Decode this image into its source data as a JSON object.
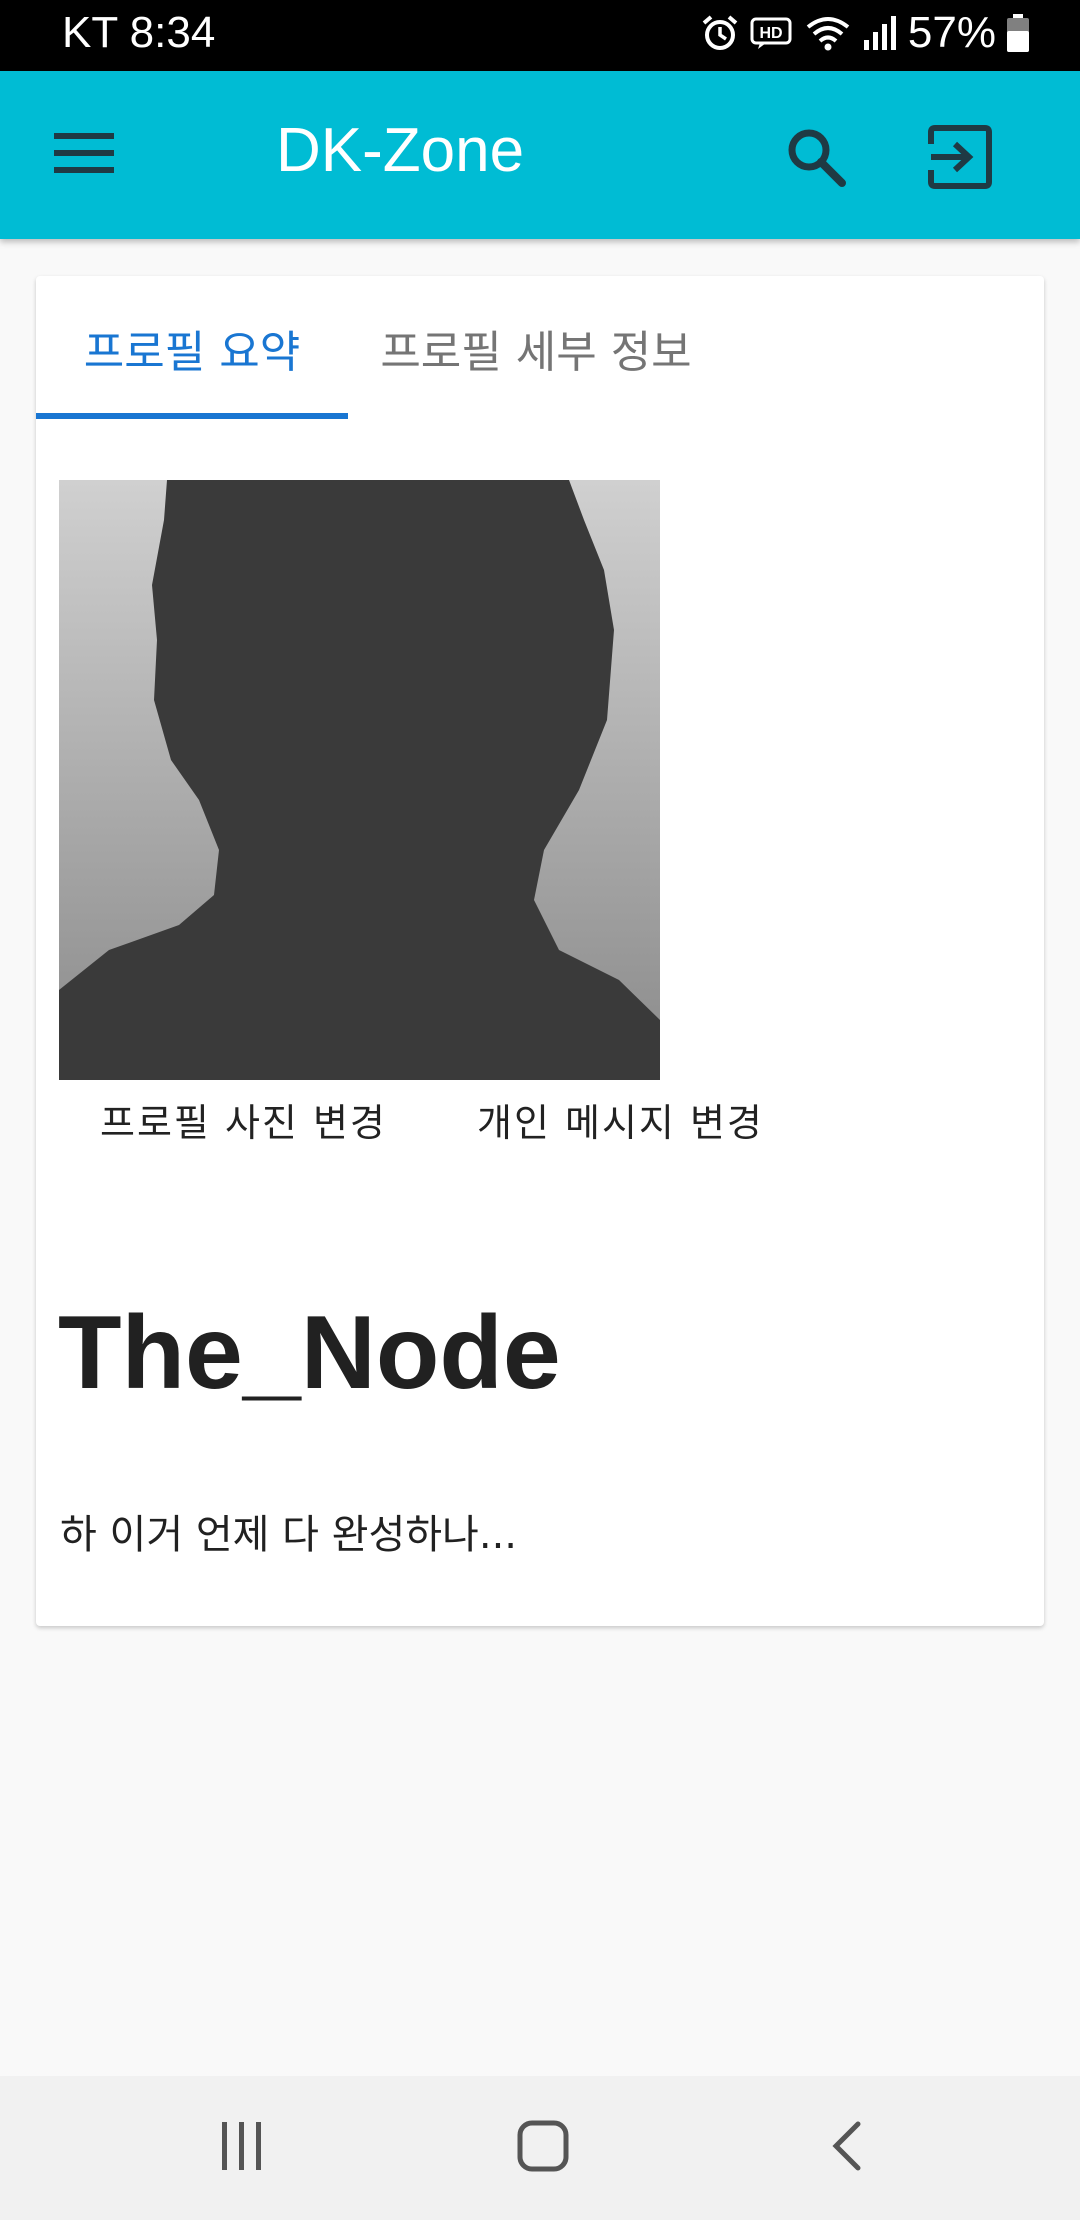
{
  "status_bar": {
    "carrier_time": "KT 8:34",
    "battery": "57%"
  },
  "app_bar": {
    "title": "DK-Zone",
    "color": "#00bcd4",
    "icons": [
      "menu-icon",
      "search-icon",
      "logout-icon"
    ]
  },
  "tabs": [
    {
      "label": "프로필 요약",
      "active": true
    },
    {
      "label": "프로필 세부 정보",
      "active": false
    }
  ],
  "profile": {
    "change_photo_label": "프로필 사진 변경",
    "change_message_label": "개인 메시지 변경",
    "username": "The_Node",
    "status_message": "하 이거 언제 다 완성하나..."
  },
  "nav_bar": {
    "icons": [
      "recent-apps-icon",
      "home-icon",
      "back-icon"
    ]
  },
  "colors": {
    "accent": "#1976d2",
    "app_bar": "#00bcd4"
  }
}
